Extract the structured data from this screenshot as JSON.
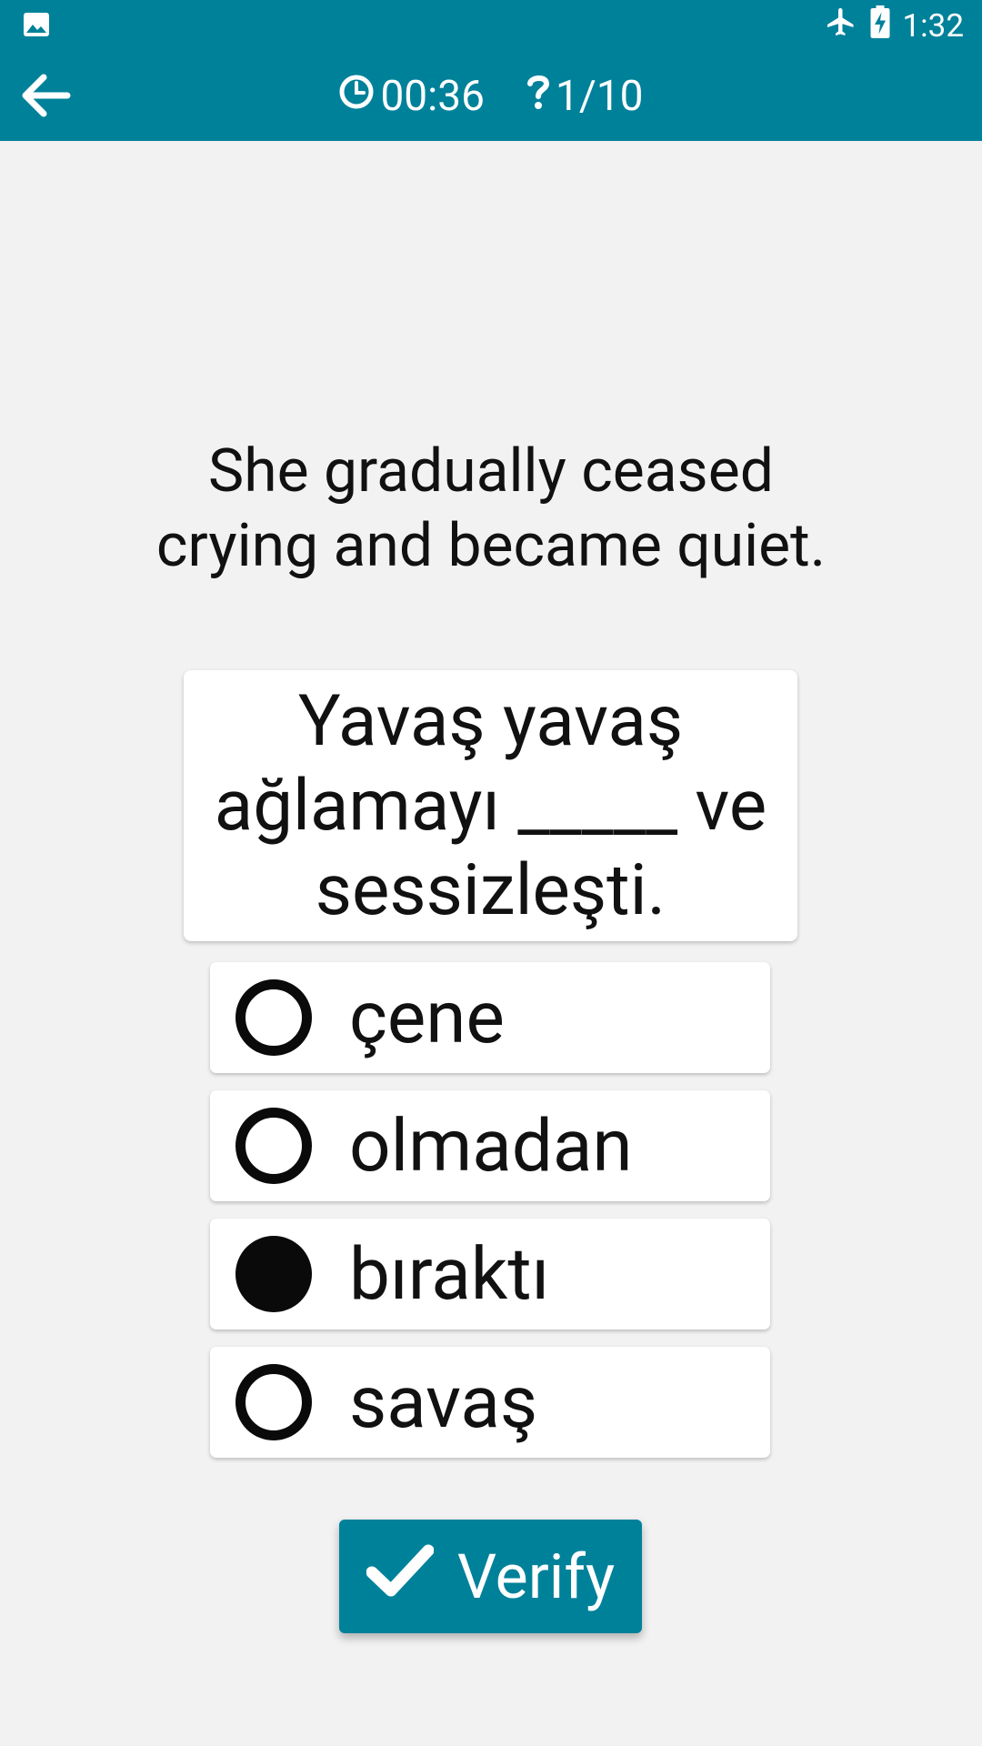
{
  "status_bar": {
    "time": "1:32",
    "icons": [
      "image-icon",
      "airplane-icon",
      "battery-charging-icon"
    ]
  },
  "toolbar": {
    "timer": "00:36",
    "progress": "1/10",
    "icons": [
      "back-arrow-icon",
      "clock-icon",
      "question-icon"
    ]
  },
  "question": {
    "english": "She gradually ceased crying and became quiet.",
    "turkish": "Yavaş yavaş ağlamayı _____ ve sessizleşti."
  },
  "options": [
    {
      "label": "çene",
      "selected": false
    },
    {
      "label": "olmadan",
      "selected": false
    },
    {
      "label": "bıraktı",
      "selected": true
    },
    {
      "label": "savaş",
      "selected": false
    }
  ],
  "verify": {
    "label": "Verify",
    "icon": "checkmark-icon"
  },
  "colors": {
    "primary": "#00819a",
    "background": "#f2f2f2",
    "card": "#ffffff",
    "text": "#111111"
  }
}
